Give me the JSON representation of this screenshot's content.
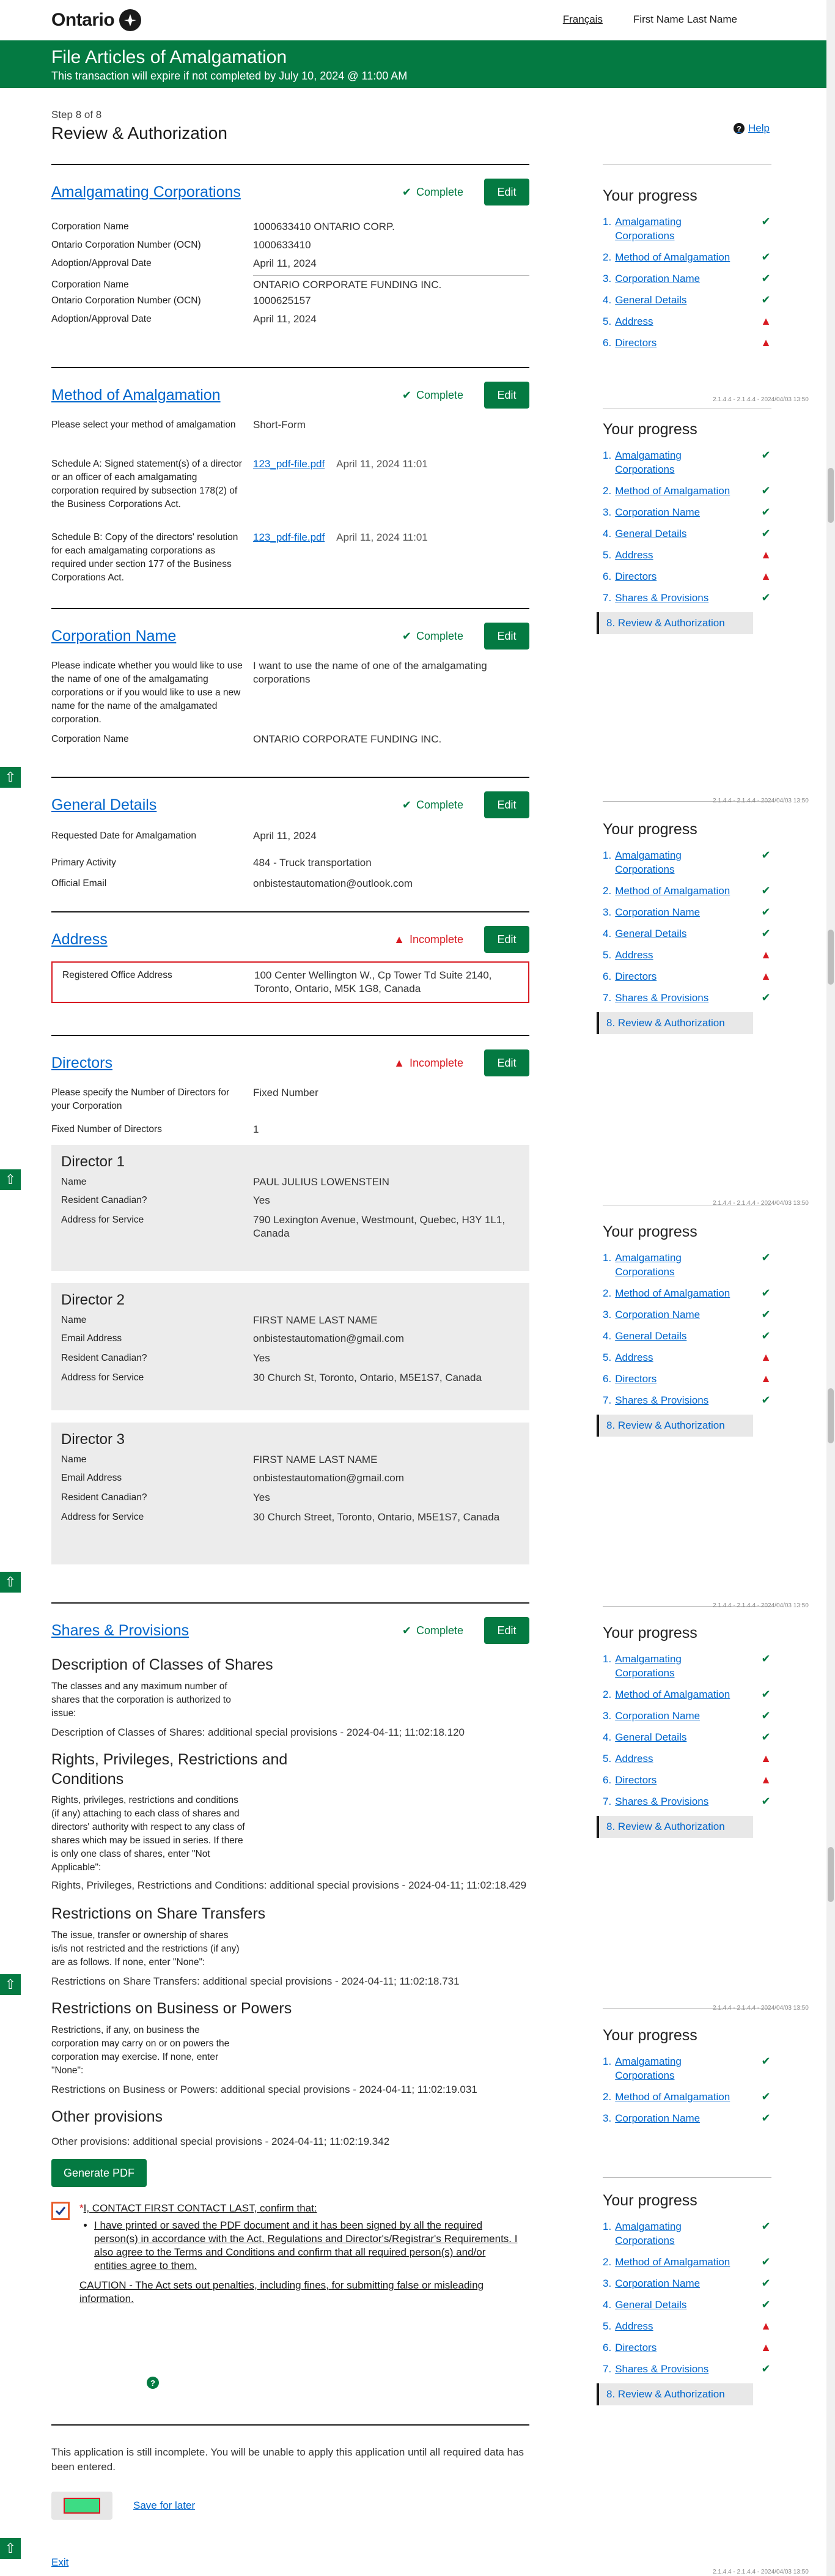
{
  "header": {
    "logo": "Ontario",
    "lang_link": "Français",
    "user": "First Name Last Name"
  },
  "banner": {
    "title": "File Articles of Amalgamation",
    "expiry": "This transaction will expire if not completed by July 10, 2024 @ 11:00 AM"
  },
  "page": {
    "step": "Step 8 of 8",
    "title": "Review & Authorization",
    "help": "Help"
  },
  "status": {
    "complete": "Complete",
    "incomplete": "Incomplete",
    "edit": "Edit"
  },
  "amalgamating": {
    "title": "Amalgamating Corporations",
    "corps": [
      {
        "name_label": "Corporation Name",
        "name": "1000633410 ONTARIO CORP.",
        "ocn_label": "Ontario Corporation Number (OCN)",
        "ocn": "1000633410",
        "date_label": "Adoption/Approval Date",
        "date": "April 11, 2024"
      },
      {
        "name_label": "Corporation Name",
        "name": "ONTARIO CORPORATE FUNDING INC.",
        "ocn_label": "Ontario Corporation Number (OCN)",
        "ocn": "1000625157",
        "date_label": "Adoption/Approval Date",
        "date": "April 11, 2024"
      }
    ]
  },
  "method": {
    "title": "Method of Amalgamation",
    "select_label": "Please select your method of amalgamation",
    "select_value": "Short-Form",
    "schedA_label": "Schedule A: Signed statement(s) of a director or an officer of each amalgamating corporation required by subsection 178(2) of the Business Corporations Act.",
    "schedA_file": "123_pdf-file.pdf",
    "schedA_date": "April 11, 2024 11:01",
    "schedB_label": "Schedule B: Copy of the directors' resolution for each amalgamating corporations as required under section 177 of the Business Corporations Act.",
    "schedB_file": "123_pdf-file.pdf",
    "schedB_date": "April 11, 2024 11:01"
  },
  "corpname": {
    "title": "Corporation Name",
    "q_label": "Please indicate whether you would like to use the name of one of the amalgamating corporations or if you would like to use a new name for the name of the amalgamated corporation.",
    "q_value": "I want to use the name of one of the amalgamating corporations",
    "name_label": "Corporation Name",
    "name_value": "ONTARIO CORPORATE FUNDING INC."
  },
  "general": {
    "title": "General Details",
    "date_label": "Requested Date for Amalgamation",
    "date": "April 11, 2024",
    "activity_label": "Primary Activity",
    "activity": "484 - Truck transportation",
    "email_label": "Official Email",
    "email": "onbistestautomation@outlook.com"
  },
  "address": {
    "title": "Address",
    "label": "Registered Office Address",
    "value": "100 Center Wellington W., Cp Tower Td Suite 2140, Toronto, Ontario, M5K 1G8, Canada"
  },
  "directors": {
    "title": "Directors",
    "num_label": "Please specify the Number of Directors for your Corporation",
    "num_value": "Fixed Number",
    "fixed_label": "Fixed Number of Directors",
    "fixed_value": "1",
    "d1": {
      "title": "Director 1",
      "name_label": "Name",
      "name": "PAUL JULIUS LOWENSTEIN",
      "res_label": "Resident Canadian?",
      "res": "Yes",
      "addr_label": "Address for Service",
      "addr": "790 Lexington Avenue, Westmount, Quebec, H3Y 1L1, Canada"
    },
    "d2": {
      "title": "Director 2",
      "name_label": "Name",
      "name": "FIRST NAME LAST NAME",
      "email_label": "Email Address",
      "email": "onbistestautomation@gmail.com",
      "res_label": "Resident Canadian?",
      "res": "Yes",
      "addr_label": "Address for Service",
      "addr": "30 Church St, Toronto, Ontario, M5E1S7, Canada"
    },
    "d3": {
      "title": "Director 3",
      "name_label": "Name",
      "name": "FIRST NAME LAST NAME",
      "email_label": "Email Address",
      "email": "onbistestautomation@gmail.com",
      "res_label": "Resident Canadian?",
      "res": "Yes",
      "addr_label": "Address for Service",
      "addr": "30 Church Street, Toronto, Ontario, M5E1S7, Canada"
    }
  },
  "shares": {
    "title": "Shares & Provisions",
    "classes_h": "Description of Classes of Shares",
    "classes_desc": "The classes and any maximum number of shares that the corporation is authorized to issue:",
    "classes_val": "Description of Classes of Shares: additional special provisions - 2024-04-11; 11:02:18.120",
    "rights_h": "Rights, Privileges, Restrictions and Conditions",
    "rights_desc": "Rights, privileges, restrictions and conditions (if any) attaching to each class of shares and directors' authority with respect to any class of shares which may be issued in series. If there is only one class of shares, enter \"Not Applicable\":",
    "rights_val": "Rights, Privileges, Restrictions and Conditions: additional special provisions - 2024-04-11; 11:02:18.429",
    "transfer_h": "Restrictions on Share Transfers",
    "transfer_desc": "The issue, transfer or ownership of shares is/is not restricted and the restrictions (if any) are as follows. If none, enter \"None\":",
    "transfer_val": "Restrictions on Share Transfers: additional special provisions - 2024-04-11; 11:02:18.731",
    "business_h": "Restrictions on Business or Powers",
    "business_desc": "Restrictions, if any, on business the corporation may carry on or on powers the corporation may exercise. If none, enter \"None\":",
    "business_val": "Restrictions on Business or Powers: additional special provisions - 2024-04-11; 11:02:19.031",
    "other_h": "Other provisions",
    "other_val": "Other provisions: additional special provisions - 2024-04-11; 11:02:19.342"
  },
  "authorize": {
    "generate": "Generate PDF",
    "confirm": "I, CONTACT FIRST CONTACT LAST, confirm that:",
    "bullet": "I have printed or saved the PDF document and it has been signed by all the required person(s) in accordance with the Act, Regulations and Director's/Registrar's Requirements. I also agree to the Terms and Conditions and confirm that all required person(s) and/or entities agree to them.",
    "caution": "CAUTION - The Act sets out penalties, including fines, for submitting false or misleading information."
  },
  "footer": {
    "incomplete": "This application is still incomplete. You will be unable to apply this application until all required data has been entered.",
    "save": "Save for later",
    "exit": "Exit"
  },
  "progress": {
    "title": "Your progress",
    "items": [
      "Amalgamating Corporations",
      "Method of Amalgamation",
      "Corporation Name",
      "General Details",
      "Address",
      "Directors",
      "Shares & Provisions"
    ],
    "current": "8. Review & Authorization",
    "version": "2.1.4.4 - 2.1.4.4 - 2024/04/03 13:50"
  }
}
